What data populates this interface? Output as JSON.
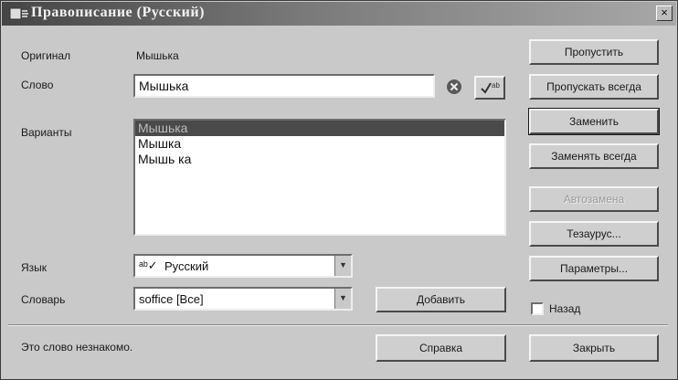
{
  "window": {
    "title": "Правописание (Русский)",
    "close_glyph": "×"
  },
  "labels": {
    "original": "Оригинал",
    "original_value": "Мышька",
    "word": "Слово",
    "variants": "Варианты",
    "language": "Язык",
    "dictionary": "Словарь"
  },
  "word_input": {
    "value": "Мышька"
  },
  "suggestions": [
    "Мышька",
    "Мышка",
    "Мышь ка"
  ],
  "selected_suggestion": 0,
  "language_select": {
    "value": "Русский"
  },
  "dictionary_select": {
    "value": "soffice [Все]"
  },
  "buttons": {
    "skip": "Пропустить",
    "skip_all": "Пропускать всегда",
    "replace": "Заменить",
    "replace_all": "Заменять всегда",
    "autocorrect": "Автозамена",
    "thesaurus": "Тезаурус...",
    "options": "Параметры...",
    "add": "Добавить",
    "help": "Справка",
    "close": "Закрыть"
  },
  "back_checkbox": {
    "label": "Назад",
    "checked": false
  },
  "status_text": "Это слово незнакомо."
}
